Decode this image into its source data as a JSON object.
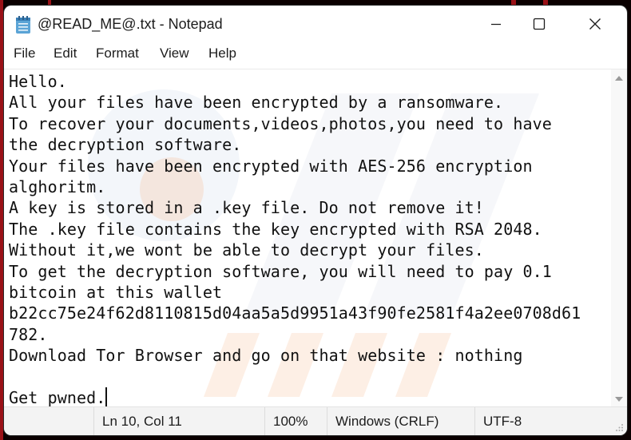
{
  "window": {
    "title": "@READ_ME@.txt - Notepad",
    "controls": {
      "minimize": "minimize",
      "maximize": "maximize",
      "close": "close"
    }
  },
  "menu": {
    "items": [
      {
        "label": "File"
      },
      {
        "label": "Edit"
      },
      {
        "label": "Format"
      },
      {
        "label": "View"
      },
      {
        "label": "Help"
      }
    ]
  },
  "editor": {
    "lines": [
      "Hello.",
      "All your files have been encrypted by a ransomware.",
      "To recover your documents,videos,photos,you need to have",
      "the decryption software.",
      "Your files have been encrypted with AES-256 encryption",
      "alghoritm.",
      "A key is stored in a .key file. Do not remove it!",
      "The .key file contains the key encrypted with RSA 2048.",
      "Without it,we wont be able to decrypt your files.",
      "To get the decryption software, you will need to pay 0.1",
      "bitcoin at this wallet",
      "b22cc75e24f62d8110815d04aa5a5d9951a43f90fe2581f4a2ee0708d61",
      "782.",
      "Download Tor Browser and go on that website : nothing",
      "",
      "Get pwned."
    ]
  },
  "statusbar": {
    "position": "Ln 10, Col 11",
    "zoom": "100%",
    "line_ending": "Windows (CRLF)",
    "encoding": "UTF-8"
  },
  "colors": {
    "accent_background": "#b3141b",
    "watermark": "#f0a080"
  }
}
